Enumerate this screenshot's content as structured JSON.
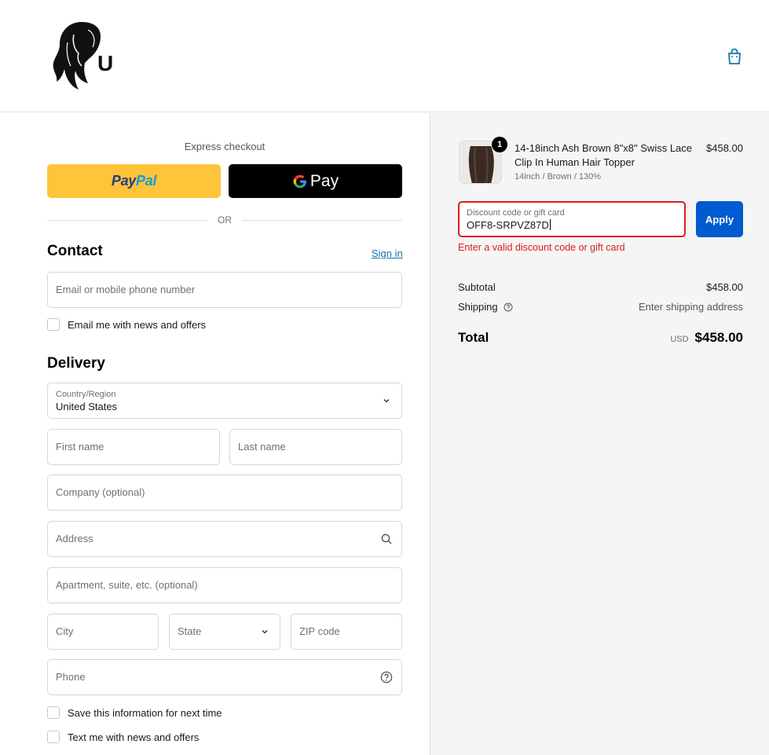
{
  "header": {
    "logo_letter": "U"
  },
  "express": {
    "title": "Express checkout",
    "paypal_part1": "Pay",
    "paypal_part2": "Pal",
    "gpay_label": "Pay",
    "or_label": "OR"
  },
  "contact": {
    "title": "Contact",
    "signin_label": "Sign in",
    "email_placeholder": "Email or mobile phone number",
    "news_label": "Email me with news and offers"
  },
  "delivery": {
    "title": "Delivery",
    "country_label": "Country/Region",
    "country_value": "United States",
    "first_name": "First name",
    "last_name": "Last name",
    "company": "Company (optional)",
    "address": "Address",
    "apartment": "Apartment, suite, etc. (optional)",
    "city": "City",
    "state": "State",
    "zip": "ZIP code",
    "phone": "Phone",
    "save_info": "Save this information for next time",
    "text_offers": "Text me with news and offers"
  },
  "order": {
    "quantity": "1",
    "product_name": "14-18inch Ash Brown 8\"x8\" Swiss Lace Clip In Human Hair Topper",
    "product_variant": "14inch / Brown / 130%",
    "product_price": "$458.00",
    "discount_label": "Discount code or gift card",
    "discount_value": "OFF8-SRPVZ87D",
    "apply_label": "Apply",
    "error_text": "Enter a valid discount code or gift card",
    "subtotal_label": "Subtotal",
    "subtotal_value": "$458.00",
    "shipping_label": "Shipping",
    "shipping_value": "Enter shipping address",
    "total_label": "Total",
    "currency": "USD",
    "total_value": "$458.00"
  },
  "colors": {
    "accent": "#005bd1",
    "error": "#dd1d1d",
    "link": "#1773b0",
    "paypal": "#ffc439"
  }
}
